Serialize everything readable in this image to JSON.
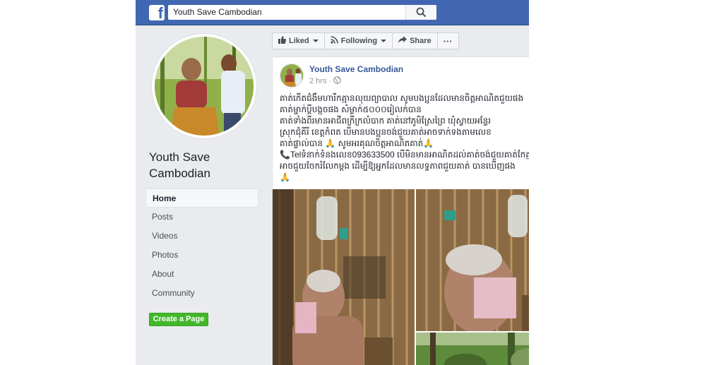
{
  "topbar": {
    "logo": "f",
    "search_value": "Youth Save Cambodian",
    "search_icon": "search-icon"
  },
  "page": {
    "name": "Youth Save Cambodian",
    "nav": [
      {
        "label": "Home",
        "active": true
      },
      {
        "label": "Posts"
      },
      {
        "label": "Videos"
      },
      {
        "label": "Photos"
      },
      {
        "label": "About"
      },
      {
        "label": "Community"
      }
    ],
    "create_button": "Create a Page"
  },
  "actions": {
    "liked": "Liked",
    "following": "Following",
    "share": "Share",
    "more": "···"
  },
  "post": {
    "author": "Youth Save Cambodian",
    "time": "2 hrs",
    "separator": "·",
    "privacy_icon": "globe-icon",
    "more": "•••",
    "lines": [
      "គាត់កើតជំងឺមហារីកគ្មានលុយព្យាបាល សូមបងប្អូនដែលមានចិត្តអាណិតជួយផង",
      "គាត់ម្នាក់ប្ដីបង្កួចផង សំម្លាក់៥០០០រៀលក់បាន",
      "គាត់ទាំងពីរមានអាជីពក្រីក្រលំបាក គាត់នៅភូមិស្រែព្រៃ ឃុំស្វាយអន្ទែរ",
      "ស្រុកជុំគីរី ខេត្តកំពត បើមានបងប្អូនចង់ជួយគាត់អាចទាក់ទងតាមលេខ",
      "គាត់ផ្ទាល់បាន 🙏 សូមអរគុណចិត្តអាណិតគាត់🙏",
      "📞Telទំនាក់ទំនងលេខ093633500 បើមិនមានអាណិតដល់គាត់ចង់ជួយគាត់កែគ្មានលុយ",
      "អាចជួយចែករំលែកម្តង ដើម្បីឱ្យអ្នកដែលមានលទ្ធភាពជួយគាត់ បានឃើញផង",
      "🙏"
    ]
  }
}
